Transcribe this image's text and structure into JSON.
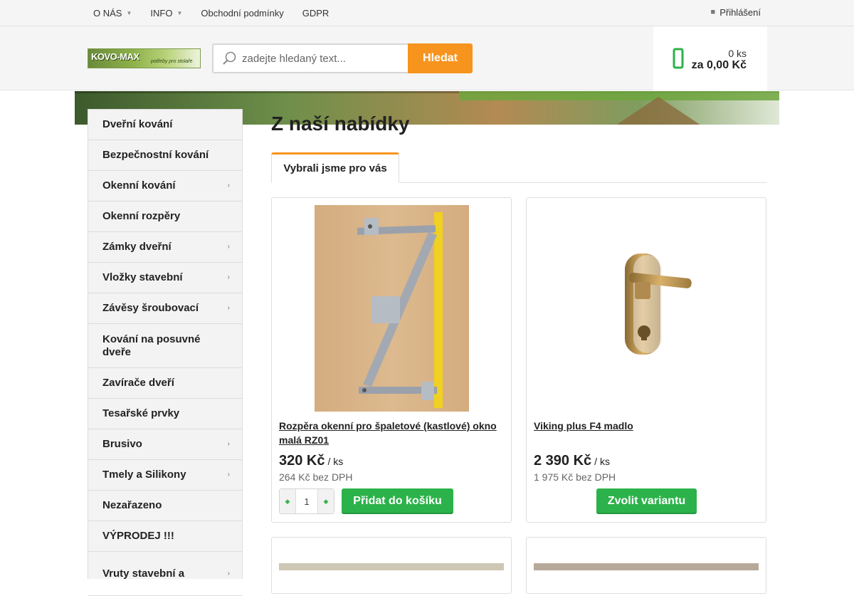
{
  "topnav": {
    "items": [
      {
        "label": "O NÁS",
        "dropdown": true
      },
      {
        "label": "INFO",
        "dropdown": true
      },
      {
        "label": "Obchodní podmínky",
        "dropdown": false
      },
      {
        "label": "GDPR",
        "dropdown": false
      }
    ],
    "login_label": "Přihlášení"
  },
  "header": {
    "logo_text": "KOVO-MAX",
    "logo_tagline": "potřeby pro stolaře",
    "search": {
      "placeholder": "zadejte hledaný text...",
      "button_label": "Hledat"
    },
    "cart": {
      "count_label": "0 ks",
      "total_label": "za 0,00 Kč"
    }
  },
  "sidebar": {
    "items": [
      {
        "label": "Dveřní kování",
        "submenu": false
      },
      {
        "label": "Bezpečnostní kování",
        "submenu": false
      },
      {
        "label": "Okenní kování",
        "submenu": true
      },
      {
        "label": "Okenní rozpěry",
        "submenu": false
      },
      {
        "label": "Zámky dveřní",
        "submenu": true
      },
      {
        "label": "Vložky stavební",
        "submenu": true
      },
      {
        "label": "Závěsy šroubovací",
        "submenu": true
      },
      {
        "label": "Kování na posuvné dveře",
        "submenu": false
      },
      {
        "label": "Zavírače dveří",
        "submenu": false
      },
      {
        "label": "Tesařské prvky",
        "submenu": false
      },
      {
        "label": "Brusivo",
        "submenu": true
      },
      {
        "label": "Tmely a Silikony",
        "submenu": true
      },
      {
        "label": "Nezařazeno",
        "submenu": false
      },
      {
        "label": "VÝPRODEJ !!!",
        "submenu": false
      },
      {
        "label": "Vruty stavební a",
        "submenu": true
      }
    ]
  },
  "main": {
    "title": "Z naší nabídky",
    "tab_label": "Vybrali jsme pro vás",
    "products": [
      {
        "name": "Rozpěra okenní pro špaletové (kastlové) okno malá RZ01",
        "price": "320 Kč",
        "unit": "/ ks",
        "net_price": "264 Kč bez DPH",
        "quantity": "1",
        "button_label": "Přidat do košíku"
      },
      {
        "name": "Viking plus F4 madlo",
        "price": "2 390 Kč",
        "unit": "/ ks",
        "net_price": "1 975 Kč bez DPH",
        "button_label": "Zvolit variantu"
      }
    ]
  },
  "colors": {
    "accent": "#f7941d",
    "green": "#2cb24a"
  }
}
